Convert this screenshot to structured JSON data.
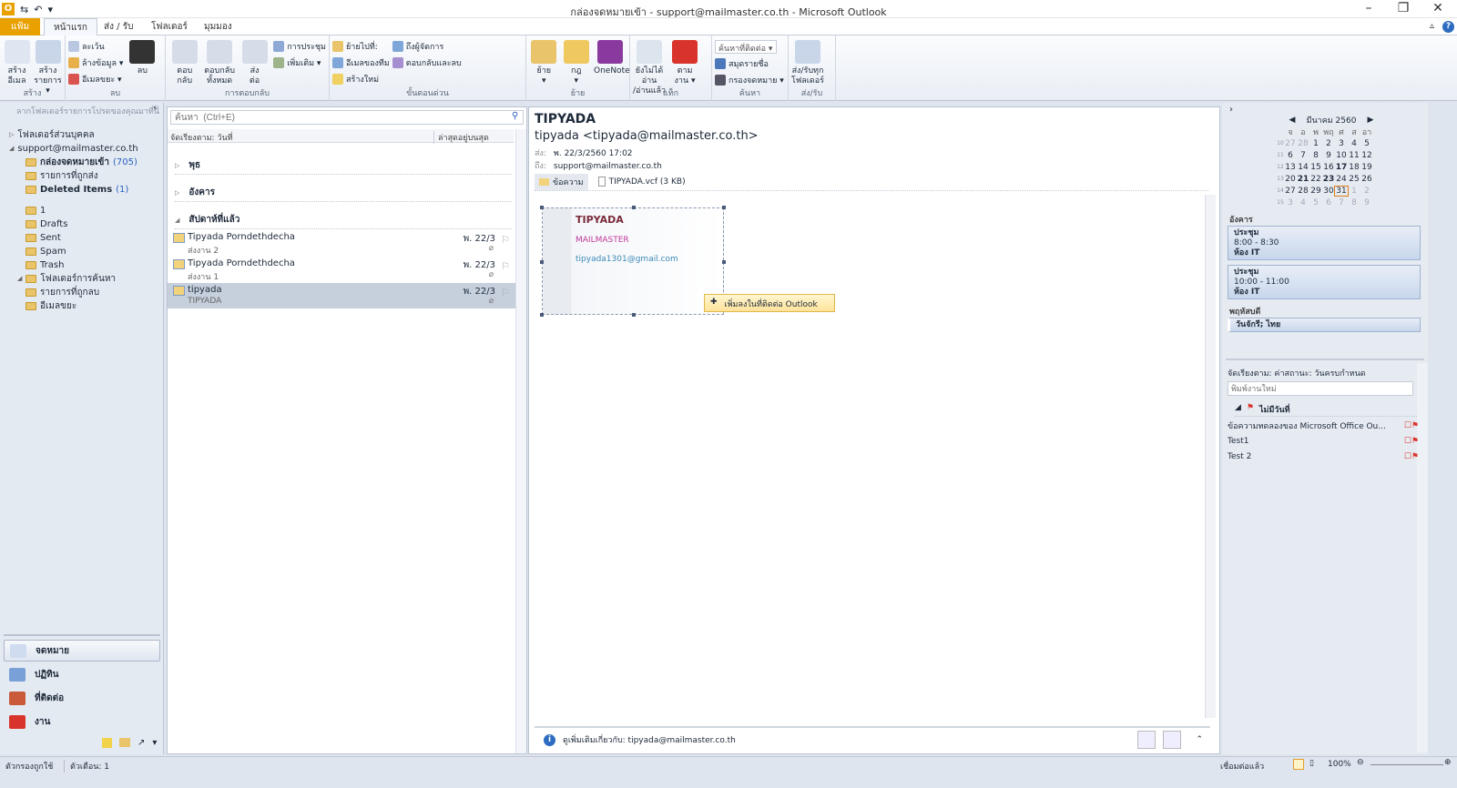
{
  "window": {
    "title": "กล่องจดหมายเข้า - support@mailmaster.co.th - Microsoft Outlook",
    "minimize": "–",
    "restore": "❐",
    "close": "✕",
    "help": "?"
  },
  "tabs": [
    "แฟ้ม",
    "หน้าแรก",
    "ส่ง / รับ",
    "โฟลเดอร์",
    "มุมมอง"
  ],
  "active_tab": "หน้าแรก",
  "ribbon": [
    {
      "label": "สร้าง",
      "items": [
        {
          "type": "large",
          "label": "สร้าง\nอีเมล",
          "icon": "new-email-icon",
          "color": "#dfe6f2"
        },
        {
          "type": "large",
          "label": "สร้าง\nรายการ ▾",
          "icon": "new-items-icon",
          "color": "#c9d6ea"
        }
      ]
    },
    {
      "label": "ลบ",
      "items": [
        {
          "type": "small",
          "col": [
            {
              "label": "ละเว้น",
              "icon": "ignore-icon",
              "color": "#b9c8e0"
            },
            {
              "label": "ล้างข้อมูล ▾",
              "icon": "clean-up-icon",
              "color": "#e8b04a"
            },
            {
              "label": "อีเมลขยะ ▾",
              "icon": "junk-icon",
              "color": "#d9534f"
            }
          ]
        },
        {
          "type": "large",
          "label": "ลบ",
          "icon": "delete-icon",
          "color": "#333"
        }
      ]
    },
    {
      "label": "การตอบกลับ",
      "items": [
        {
          "type": "large",
          "label": "ตอบ\nกลับ",
          "icon": "reply-icon",
          "color": "#d6dde8"
        },
        {
          "type": "large",
          "label": "ตอบกลับ\nทั้งหมด",
          "icon": "reply-all-icon",
          "color": "#d6dde8"
        },
        {
          "type": "large",
          "label": "ส่ง\nต่อ",
          "icon": "forward-icon",
          "color": "#d6dde8"
        },
        {
          "type": "small",
          "col": [
            {
              "label": "การประชุม",
              "icon": "meeting-icon",
              "color": "#8ea9d6"
            },
            {
              "label": "เพิ่มเติม ▾",
              "icon": "more-icon",
              "color": "#9db38a"
            }
          ]
        }
      ]
    },
    {
      "label": "ขั้นตอนด่วน",
      "items": [
        {
          "type": "small",
          "col": [
            {
              "label": "ย้ายไปที่:",
              "icon": "move-to-icon",
              "color": "#e9c46a"
            },
            {
              "label": "อีเมลของทีม",
              "icon": "team-email-icon",
              "color": "#7fa6d8"
            },
            {
              "label": "สร้างใหม่",
              "icon": "create-new-icon",
              "color": "#f0d060"
            }
          ]
        },
        {
          "type": "small",
          "col": [
            {
              "label": "ถึงผู้จัดการ",
              "icon": "to-manager-icon",
              "color": "#7fa6d8"
            },
            {
              "label": "ตอบกลับและลบ",
              "icon": "reply-delete-icon",
              "color": "#a58fd0"
            }
          ]
        }
      ]
    },
    {
      "label": "ย้าย",
      "items": [
        {
          "type": "large",
          "label": "ย้าย\n▾",
          "icon": "move-icon",
          "color": "#e9c46a"
        },
        {
          "type": "large",
          "label": "กฎ\n▾",
          "icon": "rules-icon",
          "color": "#f0c860"
        },
        {
          "type": "large",
          "label": "OneNote",
          "icon": "onenote-icon",
          "color": "#8a3a9e"
        }
      ]
    },
    {
      "label": "แท็ก",
      "items": [
        {
          "type": "large",
          "label": "ยังไม่ได้อ่าน\n/อ่านแล้ว",
          "icon": "unread-read-icon",
          "color": "#dce4ee"
        },
        {
          "type": "large",
          "label": "ตาม\nงาน ▾",
          "icon": "follow-up-icon",
          "color": "#d9342b"
        }
      ]
    },
    {
      "label": "ค้นหา",
      "items": [
        {
          "type": "small",
          "col": [
            {
              "label": "ค้นหาที่ติดต่อ ▾",
              "icon": "",
              "input": true
            },
            {
              "label": "สมุดรายชื่อ",
              "icon": "address-book-icon",
              "color": "#4a78b8"
            },
            {
              "label": "กรองจดหมาย ▾",
              "icon": "filter-icon",
              "color": "#556"
            }
          ]
        }
      ]
    },
    {
      "label": "ส่ง/รับ",
      "items": [
        {
          "type": "large",
          "label": "ส่ง/รับทุก\nโฟลเดอร์",
          "icon": "send-receive-icon",
          "color": "#c9d6ea"
        }
      ]
    }
  ],
  "nav": {
    "hint": "ลากโฟลเดอร์รายการโปรดของคุณมาที่นี่",
    "tree": [
      {
        "label": "โฟลเดอร์ส่วนบุคคล",
        "level": 0,
        "arrow": "▷"
      },
      {
        "label": "support@mailmaster.co.th",
        "level": 0,
        "arrow": "◢"
      },
      {
        "label": "กล่องจดหมายเข้า",
        "count": "(705)",
        "level": 1,
        "bold": true,
        "icon": "inbox-icon"
      },
      {
        "label": "รายการที่ถูกส่ง",
        "level": 1,
        "icon": "sent-items-icon"
      },
      {
        "label": "Deleted Items",
        "count": "(1)",
        "level": 1,
        "bold": true,
        "icon": "deleted-items-icon"
      },
      {
        "label": "",
        "level": 1,
        "spacer": true
      },
      {
        "label": "1",
        "level": 1,
        "icon": "folder-icon"
      },
      {
        "label": "Drafts",
        "level": 1,
        "icon": "folder-icon"
      },
      {
        "label": "Sent",
        "level": 1,
        "icon": "folder-icon"
      },
      {
        "label": "Spam",
        "level": 1,
        "icon": "folder-icon"
      },
      {
        "label": "Trash",
        "level": 1,
        "icon": "folder-icon"
      },
      {
        "label": "โฟลเดอร์การค้นหา",
        "level": 0.5,
        "arrow": "◢",
        "icon": "search-folder-icon"
      },
      {
        "label": "รายการที่ถูกลบ",
        "level": 1,
        "icon": "folder-icon"
      },
      {
        "label": "อีเมลขยะ",
        "level": 1,
        "icon": "junk-folder-icon"
      }
    ],
    "buttons": [
      {
        "label": "จดหมาย",
        "icon": "mail-icon",
        "color": "#cfdcef",
        "selected": true
      },
      {
        "label": "ปฏิทิน",
        "icon": "calendar-icon",
        "color": "#7aa0d8"
      },
      {
        "label": "ที่ติดต่อ",
        "icon": "contacts-icon",
        "color": "#c95a3a"
      },
      {
        "label": "งาน",
        "icon": "tasks-icon",
        "color": "#d9342b"
      }
    ]
  },
  "list": {
    "search_placeholder": "ค้นหา  (Ctrl+E)",
    "sort_by": "จัดเรียงตาม: วันที่",
    "order": "ล่าสุดอยู่บนสุด",
    "groups": [
      {
        "label": "พุธ",
        "arrow": "▷"
      },
      {
        "label": "อังคาร",
        "arrow": "▷"
      },
      {
        "label": "สัปดาห์ที่แล้ว",
        "arrow": "◢"
      }
    ],
    "messages": [
      {
        "from": "Tipyada Porndethdecha",
        "subject": "ส่งงาน 2",
        "date": "พ. 22/3",
        "attachment": true
      },
      {
        "from": "Tipyada Porndethdecha",
        "subject": "ส่งงาน 1",
        "date": "พ. 22/3",
        "attachment": true
      },
      {
        "from": "tipyada",
        "subject": "TIPYADA",
        "date": "พ. 22/3",
        "attachment": true,
        "selected": true
      }
    ]
  },
  "reading": {
    "subject": "TIPYADA",
    "from": "tipyada <tipyada@mailmaster.co.th>",
    "sent_label": "ส่ง:",
    "sent": "พ. 22/3/2560 17:02",
    "to_label": "ถึง:",
    "to": "support@mailmaster.co.th",
    "message_tab": "ข้อความ",
    "attachment": "TIPYADA.vcf (3 KB)",
    "card": {
      "name": "TIPYADA",
      "company": "MAILMASTER",
      "email": "tipyada1301@gmail.com",
      "name_color": "#7a2a3a",
      "company_color": "#c2389a",
      "email_color": "#3a8ab8"
    },
    "context_action": "เพิ่มลงในที่ติดต่อ Outlook",
    "people_pane": "ดูเพิ่มเติมเกี่ยวกับ: tipyada@mailmaster.co.th"
  },
  "todo": {
    "month": "มีนาคม 2560",
    "weekdays": [
      "จ",
      "อ",
      "พ",
      "พฤ",
      "ศ",
      "ส",
      "อา"
    ],
    "weeks": [
      {
        "wk": "10",
        "days": [
          [
            "27",
            "o"
          ],
          [
            "28",
            "o"
          ],
          [
            "1",
            ""
          ],
          [
            "2",
            ""
          ],
          [
            "3",
            ""
          ],
          [
            "4",
            ""
          ],
          [
            "5",
            ""
          ]
        ]
      },
      {
        "wk": "11",
        "days": [
          [
            "6",
            ""
          ],
          [
            "7",
            ""
          ],
          [
            "8",
            ""
          ],
          [
            "9",
            ""
          ],
          [
            "10",
            ""
          ],
          [
            "11",
            ""
          ],
          [
            "12",
            ""
          ]
        ]
      },
      {
        "wk": "12",
        "days": [
          [
            "13",
            ""
          ],
          [
            "14",
            ""
          ],
          [
            "15",
            ""
          ],
          [
            "16",
            ""
          ],
          [
            "17",
            "b"
          ],
          [
            "18",
            ""
          ],
          [
            "19",
            ""
          ]
        ]
      },
      {
        "wk": "13",
        "days": [
          [
            "20",
            ""
          ],
          [
            "21",
            "b"
          ],
          [
            "22",
            ""
          ],
          [
            "23",
            "b"
          ],
          [
            "24",
            ""
          ],
          [
            "25",
            ""
          ],
          [
            "26",
            ""
          ]
        ]
      },
      {
        "wk": "14",
        "days": [
          [
            "27",
            ""
          ],
          [
            "28",
            ""
          ],
          [
            "29",
            ""
          ],
          [
            "30",
            ""
          ],
          [
            "31",
            "t"
          ],
          [
            "1",
            "o"
          ],
          [
            "2",
            "o"
          ]
        ]
      },
      {
        "wk": "15",
        "days": [
          [
            "3",
            "o"
          ],
          [
            "4",
            "o"
          ],
          [
            "5",
            "o"
          ],
          [
            "6",
            "o"
          ],
          [
            "7",
            "o"
          ],
          [
            "8",
            "o"
          ],
          [
            "9",
            "o"
          ]
        ]
      }
    ],
    "day1": "อังคาร",
    "appointments": [
      {
        "title": "ประชุม",
        "time": "8:00 - 8:30",
        "location": "ห้อง IT"
      },
      {
        "title": "ประชุม",
        "time": "10:00 - 11:00",
        "location": "ห้อง IT"
      }
    ],
    "day2": "พฤหัสบดี",
    "holiday": "วันจักรี; ไทย",
    "task_sort": "จัดเรียงตาม: ค่าสถานะ: วันครบกำหนด",
    "task_placeholder": "พิมพ์งานใหม่",
    "task_group": "ไม่มีวันที่",
    "tasks": [
      "ข้อความทดลองของ Microsoft Office Ou...",
      "Test1",
      "Test 2"
    ]
  },
  "status": {
    "filter": "ตัวกรองถูกใช้",
    "reminders": "ตัวเตือน: 1",
    "connection": "เชื่อมต่อแล้ว",
    "zoom": "100%"
  },
  "colors": {
    "file_tab": "#e8a100",
    "accent": "#2a62c0",
    "selected_row": "#c6cfdc",
    "flag": "#d9342b"
  }
}
